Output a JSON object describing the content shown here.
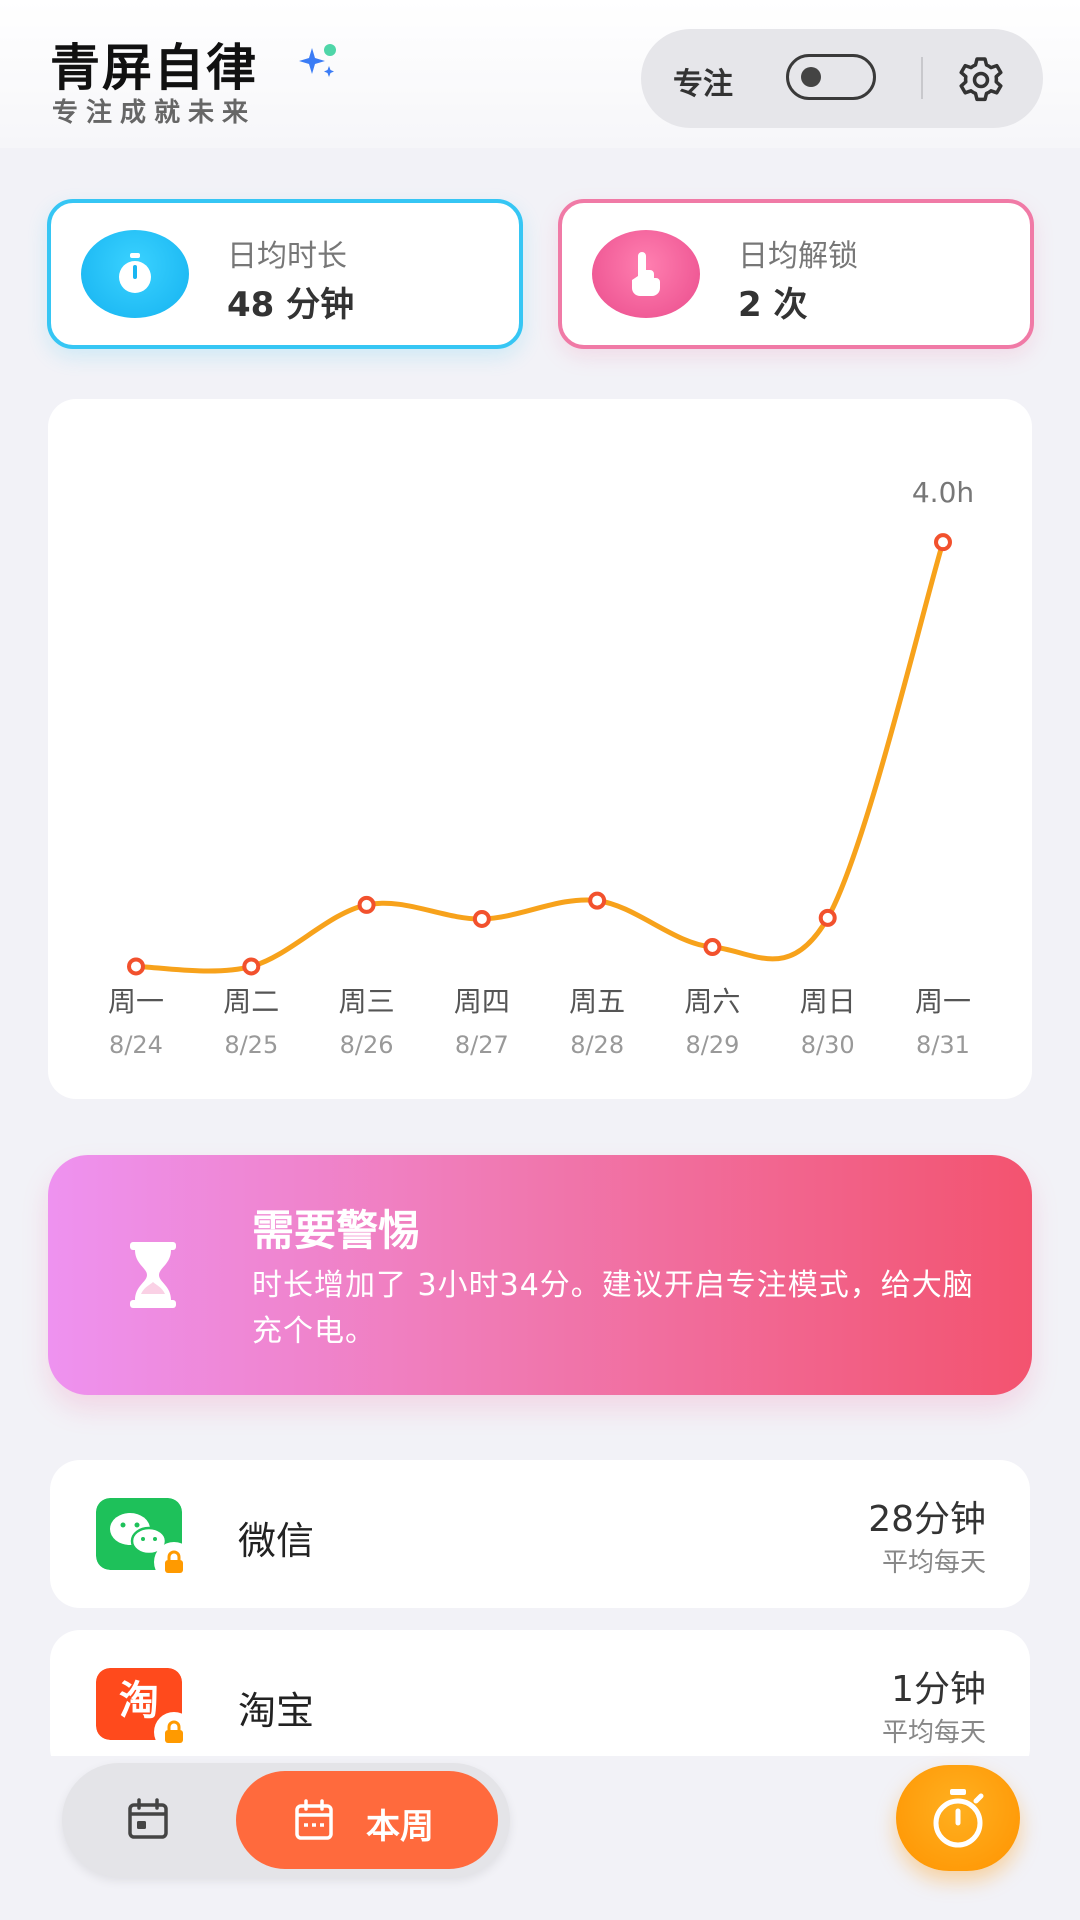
{
  "header": {
    "title": "青屏自律",
    "subtitle": "专注成就未来",
    "focus_label": "专注",
    "focus_toggle_on": false
  },
  "stats": [
    {
      "label": "日均时长",
      "value": "48 分钟",
      "icon": "stopwatch-icon",
      "color": "#36c6f4"
    },
    {
      "label": "日均解锁",
      "value": "2 次",
      "icon": "tap-hand-icon",
      "color": "#f07aa6"
    }
  ],
  "chart_data": {
    "type": "line",
    "categories": [
      "周一",
      "周二",
      "周三",
      "周四",
      "周五",
      "周六",
      "周日",
      "周一"
    ],
    "dates": [
      "8/24",
      "8/25",
      "8/26",
      "8/27",
      "8/28",
      "8/29",
      "8/30",
      "8/31"
    ],
    "series": [
      {
        "values": [
          0.07,
          0.07,
          0.64,
          0.51,
          0.68,
          0.25,
          0.52,
          4.0
        ],
        "color": "#f7a21b"
      }
    ],
    "peak_label": "4.0h",
    "ylim": [
      0,
      4.4
    ],
    "grid": false
  },
  "alert": {
    "title": "需要警惕",
    "text": "时长增加了 3小时34分。建议开启专注模式，给大脑充个电。",
    "icon": "hourglass-icon"
  },
  "apps": [
    {
      "name": "微信",
      "time": "28分钟",
      "sub": "平均每天",
      "icon": "wechat-icon",
      "locked": true
    },
    {
      "name": "淘宝",
      "time": "1分钟",
      "sub": "平均每天",
      "icon": "taobao-icon",
      "locked": true
    }
  ],
  "bottom_nav": {
    "week_label": "本周",
    "accent": "#ff6a3d",
    "fab_color": "#ff9c10"
  }
}
